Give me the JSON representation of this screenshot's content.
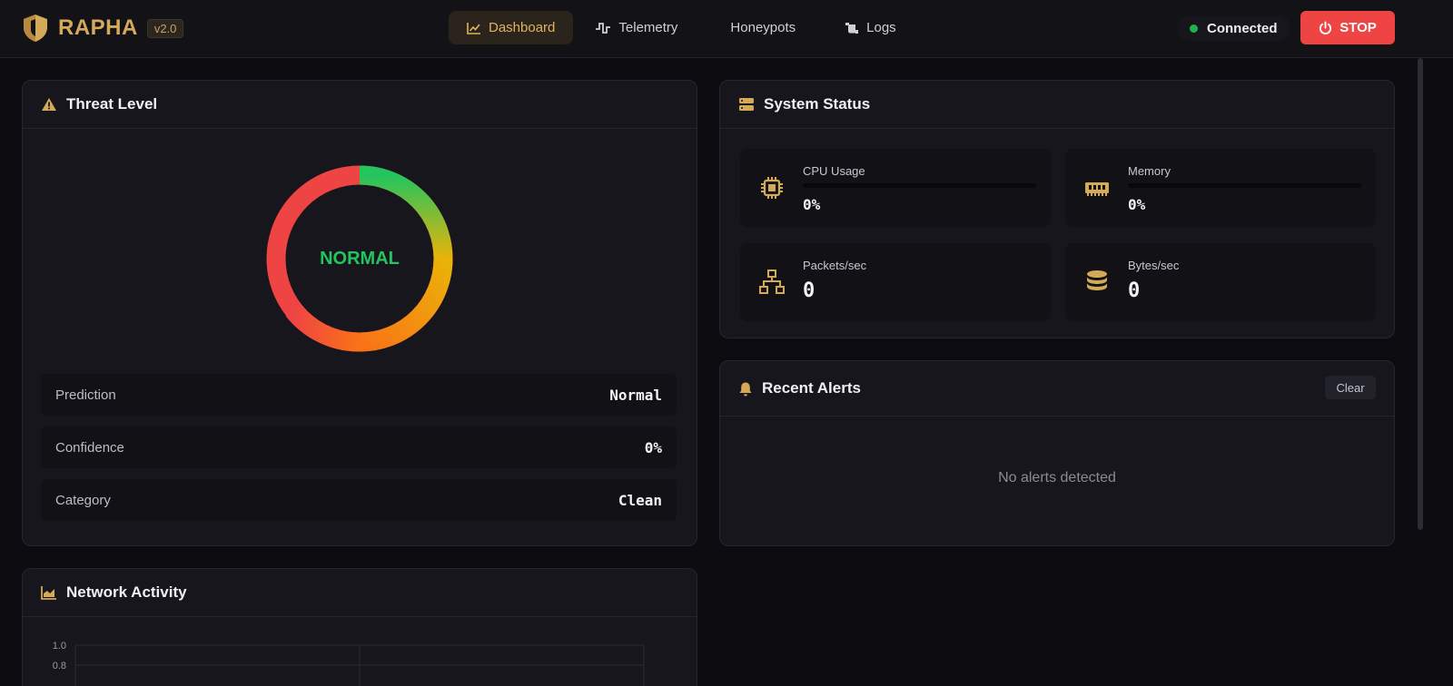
{
  "header": {
    "brand": "RAPHA",
    "version": "v2.0",
    "nav": [
      {
        "label": "Dashboard",
        "icon": "chart-line-icon",
        "active": true
      },
      {
        "label": "Telemetry",
        "icon": "pulse-icon",
        "active": false
      },
      {
        "label": "Honeypots",
        "icon": "",
        "active": false
      },
      {
        "label": "Logs",
        "icon": "scroll-icon",
        "active": false
      }
    ],
    "status": "Connected",
    "stop_label": "STOP"
  },
  "threat": {
    "title": "Threat Level",
    "gauge_label": "NORMAL",
    "rows": [
      {
        "label": "Prediction",
        "value": "Normal"
      },
      {
        "label": "Confidence",
        "value": "0%"
      },
      {
        "label": "Category",
        "value": "Clean"
      }
    ]
  },
  "system": {
    "title": "System Status",
    "tiles": [
      {
        "label": "CPU Usage",
        "value": "0%",
        "icon": "cpu-icon",
        "bar": 0
      },
      {
        "label": "Memory",
        "value": "0%",
        "icon": "memory-icon",
        "bar": 0
      },
      {
        "label": "Packets/sec",
        "value": "0",
        "icon": "network-icon"
      },
      {
        "label": "Bytes/sec",
        "value": "0",
        "icon": "database-icon"
      }
    ]
  },
  "alerts": {
    "title": "Recent Alerts",
    "clear_label": "Clear",
    "empty_text": "No alerts detected"
  },
  "network": {
    "title": "Network Activity"
  },
  "chart_data": {
    "type": "line",
    "title": "",
    "xlabel": "",
    "ylabel": "",
    "yticks": [
      "1.0",
      "0.8"
    ],
    "ylim": [
      0,
      1.0
    ],
    "series": [],
    "grid": true
  },
  "colors": {
    "accent": "#d4a957",
    "danger": "#ef4444",
    "success": "#22c55e",
    "gauge_gradient": [
      "#22c55e",
      "#eab308",
      "#f97316",
      "#ef4444"
    ]
  }
}
